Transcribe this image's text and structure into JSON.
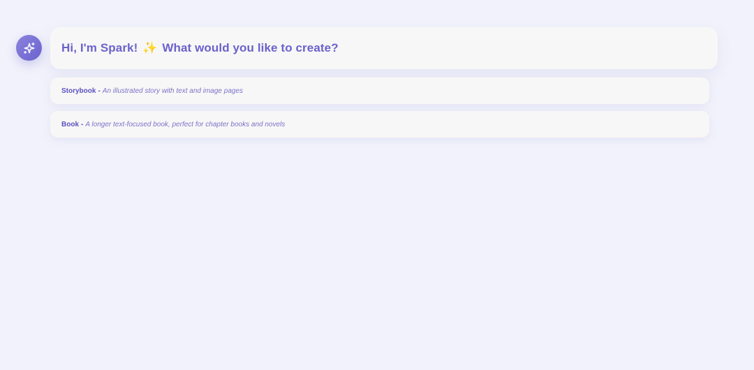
{
  "assistant": {
    "avatar_icon": "sparkles-icon",
    "greeting_prefix": "Hi, I'm Spark!",
    "greeting_emoji": "✨",
    "greeting_suffix": "What would you like to create?"
  },
  "options": [
    {
      "title": "Storybook",
      "separator": "-",
      "description": "An illustrated story with text and image pages"
    },
    {
      "title": "Book",
      "separator": "-",
      "description": "A longer text-focused book, perfect for chapter books and novels"
    }
  ],
  "colors": {
    "accent": "#6a62cc",
    "background": "#f1f2fb",
    "card": "#f8f7f7"
  }
}
